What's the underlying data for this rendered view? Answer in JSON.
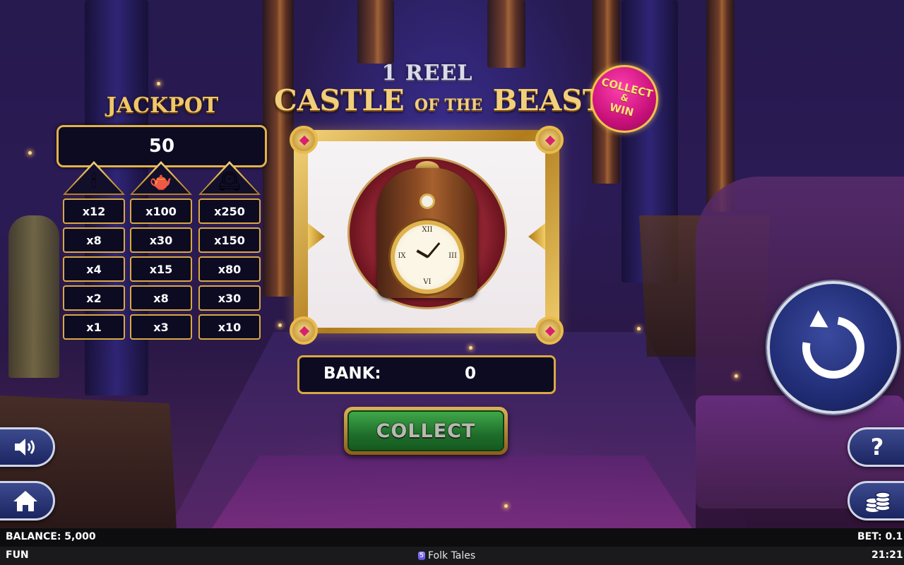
{
  "title": {
    "line1": "1 REEL",
    "word1": "CASTLE",
    "word2": "OF THE",
    "word3": "BEAST",
    "badge": [
      "COLLECT",
      "&",
      "WIN"
    ]
  },
  "jackpot": {
    "label": "JACKPOT",
    "value": "50"
  },
  "paytable": {
    "symbols": [
      {
        "icon": "candelabra-icon",
        "glyph": "🕯"
      },
      {
        "icon": "teapot-icon",
        "glyph": "🫖"
      },
      {
        "icon": "clock-icon",
        "glyph": "🕰"
      }
    ],
    "rows": [
      [
        "x12",
        "x100",
        "x250"
      ],
      [
        "x8",
        "x30",
        "x150"
      ],
      [
        "x4",
        "x15",
        "x80"
      ],
      [
        "x2",
        "x8",
        "x30"
      ],
      [
        "x1",
        "x3",
        "x10"
      ]
    ]
  },
  "reel": {
    "symbol": "clock-icon",
    "clock_numerals": [
      "XII",
      "III",
      "VI",
      "IX"
    ]
  },
  "bank": {
    "label": "BANK:",
    "value": "0"
  },
  "buttons": {
    "collect": "COLLECT",
    "help": "?",
    "spin_icon": "spin-icon",
    "sound_icon": "speaker-icon",
    "home_icon": "home-icon",
    "bet_icon": "coins-icon"
  },
  "status": {
    "balance": "BALANCE: 5,000",
    "mode": "FUN",
    "bet": "BET: 0.1",
    "time": "21:21",
    "provider_logo": "5",
    "provider": "Folk Tales"
  },
  "colors": {
    "gold": "#e2b24a",
    "panel": "#0c0b22",
    "collect_green": "#2f8a3a",
    "badge_pink": "#d81a86",
    "spin_blue": "#202c74"
  }
}
